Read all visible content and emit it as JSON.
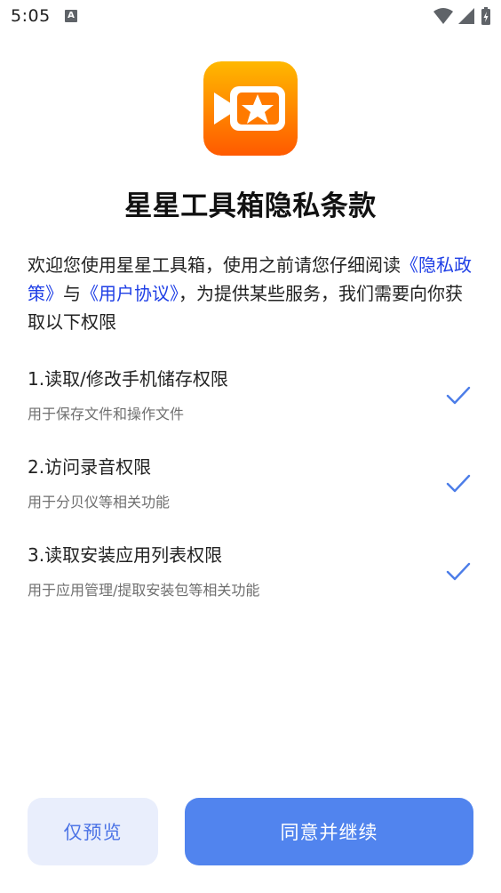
{
  "status_bar": {
    "time": "5:05",
    "notification_icon_letter": "A",
    "icons": [
      "wifi-icon",
      "signal-icon",
      "battery-charging-icon"
    ]
  },
  "app": {
    "logo_icon": "video-star-logo",
    "logo_colors": [
      "#ffb800",
      "#ff5a00"
    ]
  },
  "dialog": {
    "title": "星星工具箱隐私条款",
    "intro_before": "欢迎您使用星星工具箱，使用之前请您仔细阅读",
    "privacy_link": "《隐私政策》",
    "conjunction": "与",
    "agreement_link": "《用户协议》",
    "intro_after": "，为提供某些服务，我们需要向你获取以下权限",
    "link_color": "#1f3fe6"
  },
  "permissions": [
    {
      "title": "1.读取/修改手机储存权限",
      "desc": "用于保存文件和操作文件",
      "granted_icon": "check-icon"
    },
    {
      "title": "2.访问录音权限",
      "desc": "用于分贝仪等相关功能",
      "granted_icon": "check-icon"
    },
    {
      "title": "3.读取安装应用列表权限",
      "desc": "用于应用管理/提取安装包等相关功能",
      "granted_icon": "check-icon"
    }
  ],
  "buttons": {
    "preview_label": "仅预览",
    "agree_label": "同意并继续",
    "accent_color": "#5184ee"
  }
}
